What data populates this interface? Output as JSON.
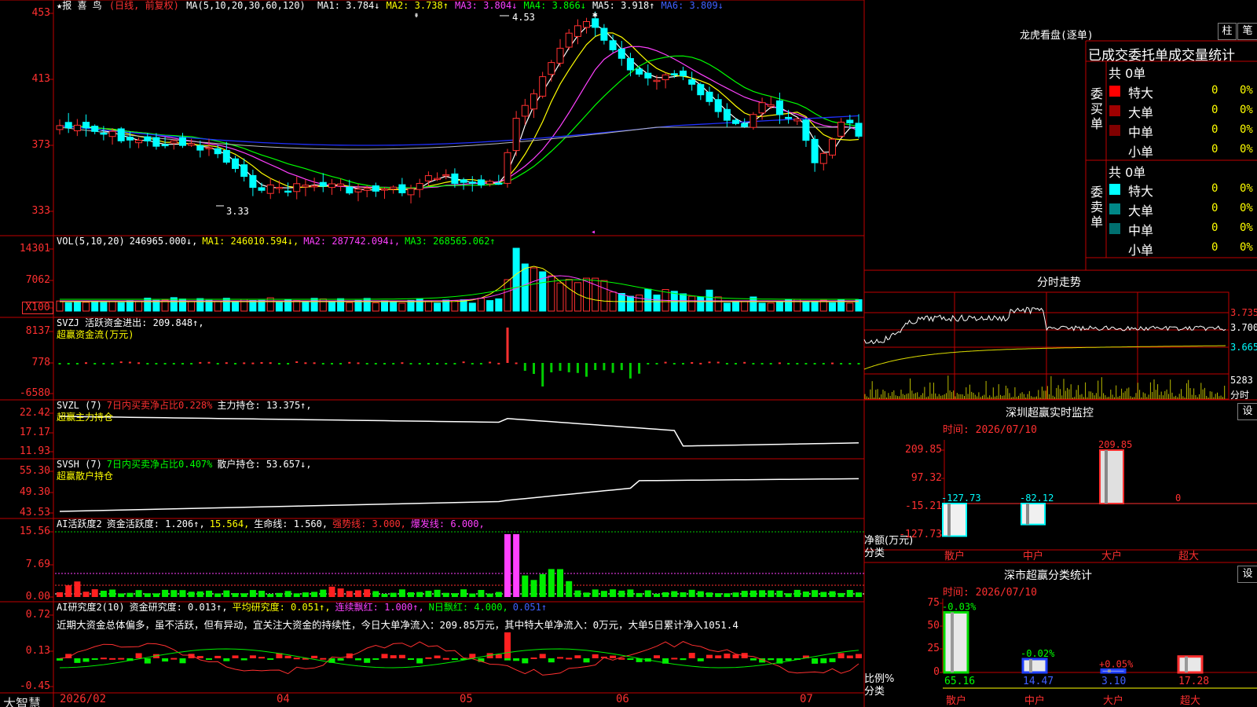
{
  "header": {
    "title": "★报 喜 鸟",
    "period": "(日线, 前复权)",
    "ma_label": "MA(5,10,20,30,60,120)",
    "ma_values": [
      {
        "t": "MA1: 3.784↓",
        "c": "#ffffff"
      },
      {
        "t": "MA2: 3.738↑",
        "c": "#ffff00"
      },
      {
        "t": "MA3: 3.804↓",
        "c": "#ff40ff"
      },
      {
        "t": "MA4: 3.866↓",
        "c": "#00ff00"
      },
      {
        "t": "MA5: 3.918↑",
        "c": "#ffffff"
      },
      {
        "t": "MA6: 3.809↓",
        "c": "#4060ff"
      }
    ],
    "high_label": "4.53",
    "low_label": "3.33"
  },
  "price_axis": [
    "453",
    "413",
    "373",
    "333"
  ],
  "vol": {
    "axis": [
      "14301",
      "7062",
      "X100"
    ],
    "legend": [
      {
        "t": "VOL(5,10,20)",
        "c": "#ffffff"
      },
      {
        "t": "246965.000↓,",
        "c": "#ffffff"
      },
      {
        "t": "MA1: 246010.594↓,",
        "c": "#ffff00"
      },
      {
        "t": "MA2: 287742.094↓,",
        "c": "#ff40ff"
      },
      {
        "t": "MA3: 268565.062↑",
        "c": "#00ff00"
      }
    ]
  },
  "svzj": {
    "axis": [
      "8137",
      "778",
      "-6580"
    ],
    "legend": [
      {
        "t": "SVZJ  活跃资金进出: 209.848↑,",
        "c": "#ffffff"
      }
    ],
    "sub": "超赢资金流(万元)"
  },
  "svzl": {
    "axis": [
      "22.42",
      "17.17",
      "11.93"
    ],
    "legend": [
      {
        "t": "SVZL (7)",
        "c": "#ffffff"
      },
      {
        "t": "7日内买卖净占比0.228%",
        "c": "#ff3030"
      },
      {
        "t": "主力持仓: 13.375↑,",
        "c": "#ffffff"
      }
    ],
    "sub": "超赢主力持仓"
  },
  "svsh": {
    "axis": [
      "55.30",
      "49.30",
      "43.53"
    ],
    "legend": [
      {
        "t": "SVSH (7)",
        "c": "#ffffff"
      },
      {
        "t": "7日内买卖净占比0.407%",
        "c": "#00ff00"
      },
      {
        "t": "散户持仓: 53.657↓,",
        "c": "#ffffff"
      }
    ],
    "sub": "超赢散户持仓"
  },
  "ai2": {
    "axis": [
      "15.56",
      "7.69",
      "0.00"
    ],
    "legend": [
      {
        "t": "AI活跃度2",
        "c": "#ffffff"
      },
      {
        "t": "资金活跃度: 1.206↑,",
        "c": "#ffffff"
      },
      {
        "t": "15.564,",
        "c": "#ffff00"
      },
      {
        "t": "生命线: 1.560,",
        "c": "#ffffff"
      },
      {
        "t": "强势线: 3.000,",
        "c": "#ff3030"
      },
      {
        "t": "爆发线: 6.000,",
        "c": "#ff40ff"
      }
    ]
  },
  "airesearch": {
    "axis": [
      "0.72",
      "0.13",
      "-0.45"
    ],
    "legend": [
      {
        "t": "AI研究度2(10)",
        "c": "#ffffff"
      },
      {
        "t": "资金研究度: 0.013↑,",
        "c": "#ffffff"
      },
      {
        "t": "平均研究度: 0.051↑,",
        "c": "#ffff00"
      },
      {
        "t": "连续飘红: 1.000↑,",
        "c": "#ff40ff"
      },
      {
        "t": "N日飘红: 4.000,",
        "c": "#00ff00"
      },
      {
        "t": "0.051↑",
        "c": "#4060ff"
      }
    ],
    "comment": "近期大资金总体偏多，虽不活跃，但有异动，宜关注大资金的持续性，今日大单净流入：209.85万元，其中特大单净流入：0万元，大单5日累计净入1051.4"
  },
  "bottom": {
    "logo": "大智慧",
    "dates": [
      "2026/02",
      "04",
      "05",
      "06",
      "07"
    ]
  },
  "right": {
    "lhb_title": "龙虎看盘(逐单)",
    "btn_zhu": "柱",
    "btn_bi": "笔",
    "table_title": "已成交委托单成交量统计",
    "buy_label": "委买单",
    "sell_label": "委卖单",
    "buy_total": "共 0单",
    "sell_total": "共 0单",
    "buy_rows": [
      {
        "name": "特大",
        "val": "0",
        "pct": "0%",
        "color": "#ff0000"
      },
      {
        "name": "大单",
        "val": "0",
        "pct": "0%",
        "color": "#a00000"
      },
      {
        "name": "中单",
        "val": "0",
        "pct": "0%",
        "color": "#800000"
      },
      {
        "name": "小单",
        "val": "0",
        "pct": "0%",
        "color": ""
      }
    ],
    "sell_rows": [
      {
        "name": "特大",
        "val": "0",
        "pct": "0%",
        "color": "#00ffff"
      },
      {
        "name": "大单",
        "val": "0",
        "pct": "0%",
        "color": "#008888"
      },
      {
        "name": "中单",
        "val": "0",
        "pct": "0%",
        "color": "#007070"
      },
      {
        "name": "小单",
        "val": "0",
        "pct": "0%",
        "color": ""
      }
    ],
    "fenshi_title": "分时走势",
    "fenshi_axis": [
      "3.735",
      "3.700",
      "3.665"
    ],
    "fenshi_vol": [
      "5283",
      "分时"
    ],
    "sz_title": "深圳超赢实时监控",
    "sz_btn": "设",
    "sz_time": "时间: 2026/07/10",
    "sz_axis": [
      "209.85",
      "97.32",
      "-15.21",
      "-127.73"
    ],
    "sz_ylabel": [
      "净额(万元)",
      "分类"
    ],
    "sz_bars": [
      {
        "cat": "散户",
        "value": -127.73,
        "label": "-127.73"
      },
      {
        "cat": "中户",
        "value": -82.12,
        "label": "-82.12"
      },
      {
        "cat": "大户",
        "value": 209.85,
        "label": "209.85"
      },
      {
        "cat": "超大",
        "value": 0,
        "label": "0"
      }
    ],
    "cls_title": "深市超赢分类统计",
    "cls_btn": "设",
    "cls_time": "时间: 2026/07/10",
    "cls_axis": [
      "75",
      "50",
      "25",
      "0"
    ],
    "cls_ylabel": [
      "比例%",
      "分类"
    ],
    "cls_bars": [
      {
        "cat": "散户",
        "value": 65.16,
        "label": "65.16",
        "delta": "-0.03%"
      },
      {
        "cat": "中户",
        "value": 14.47,
        "label": "14.47",
        "delta": "-0.02%"
      },
      {
        "cat": "大户",
        "value": 3.1,
        "label": "3.10",
        "delta": "+0.05%"
      },
      {
        "cat": "超大",
        "value": 17.28,
        "label": "17.28",
        "delta": ""
      }
    ]
  },
  "chart_data": {
    "type": "candlestick",
    "x": [
      "2026/02",
      "04",
      "05",
      "06",
      "07"
    ],
    "ylim": [
      3.33,
      4.53
    ],
    "high": 4.53,
    "low": 3.33,
    "moving_averages": {
      "MA1": 3.784,
      "MA2": 3.738,
      "MA3": 3.804,
      "MA4": 3.866,
      "MA5": 3.918,
      "MA6": 3.809
    }
  }
}
